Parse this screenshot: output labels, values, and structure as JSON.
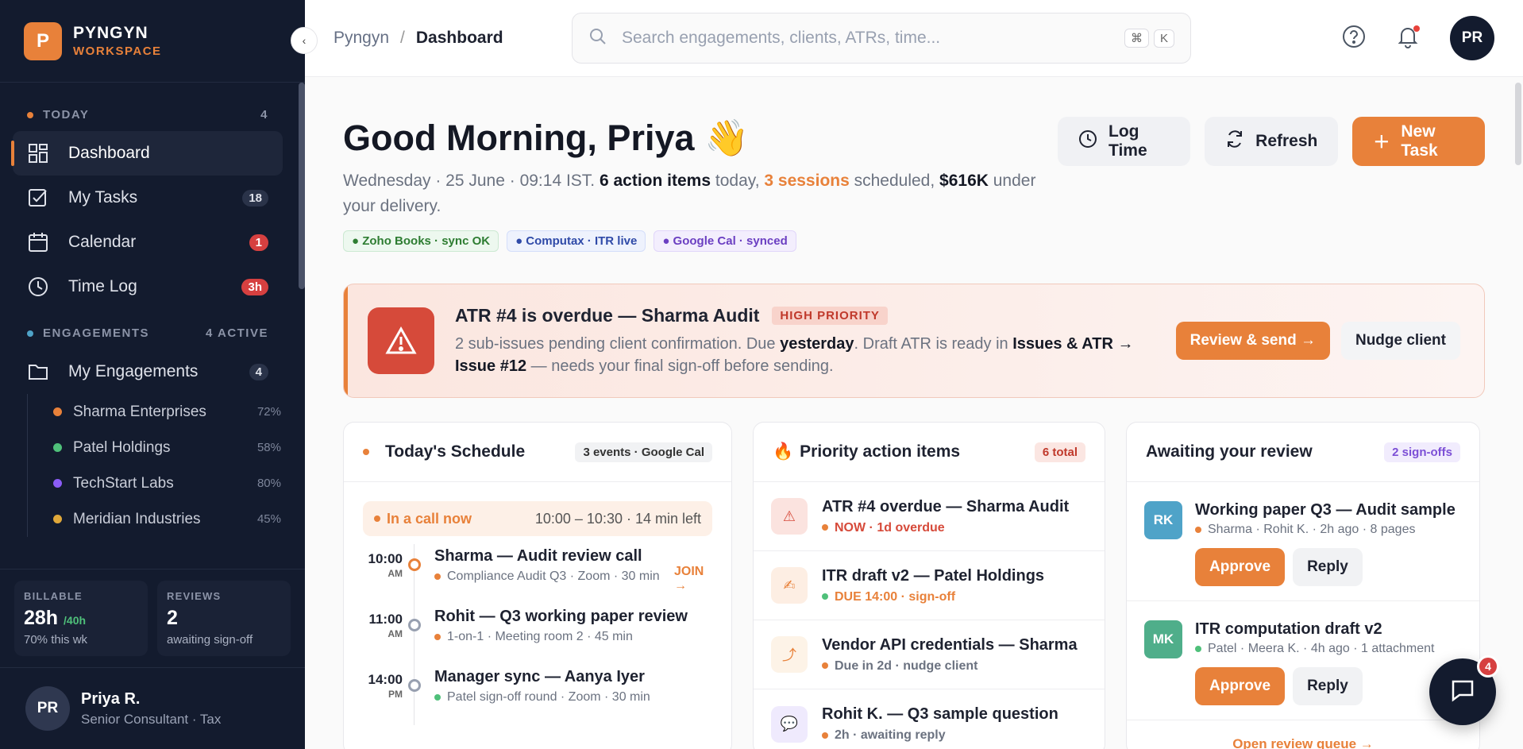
{
  "brand": {
    "initial": "P",
    "name": "PYNGYN",
    "sub": "WORKSPACE"
  },
  "sidebar": {
    "today_label": "TODAY",
    "today_count": "4",
    "nav": [
      {
        "label": "Dashboard",
        "badge": ""
      },
      {
        "label": "My Tasks",
        "badge": "18"
      },
      {
        "label": "Calendar",
        "badge": "1"
      },
      {
        "label": "Time Log",
        "badge": "3h"
      }
    ],
    "engagements_label": "ENGAGEMENTS",
    "engagements_count": "4 ACTIVE",
    "my_engagements": {
      "label": "My Engagements",
      "badge": "4"
    },
    "clients": [
      {
        "name": "Sharma Enterprises",
        "pct": "72%",
        "color": "#e8813a"
      },
      {
        "name": "Patel Holdings",
        "pct": "58%",
        "color": "#4fc07a"
      },
      {
        "name": "TechStart Labs",
        "pct": "80%",
        "color": "#8b5cf6"
      },
      {
        "name": "Meridian Industries",
        "pct": "45%",
        "color": "#e0a83a"
      }
    ],
    "stats": [
      {
        "label": "BILLABLE",
        "value": "28h",
        "extra": "/40h",
        "sub": "70% this wk"
      },
      {
        "label": "REVIEWS",
        "value": "2",
        "extra": "",
        "sub": "awaiting sign-off"
      }
    ],
    "user": {
      "initials": "PR",
      "name": "Priya R.",
      "role": "Senior Consultant · Tax"
    }
  },
  "topbar": {
    "crumb_root": "Pyngyn",
    "crumb_sep": "/",
    "crumb_page": "Dashboard",
    "search_placeholder": "Search engagements, clients, ATRs, time...",
    "kbd1": "⌘",
    "kbd2": "K",
    "avatar": "PR"
  },
  "hero": {
    "greeting": "Good Morning, Priya",
    "wave": "👋",
    "date": "Wednesday · 25 June · 09:14 IST.",
    "actions": "6 action items",
    "t1": " today, ",
    "sessions": "3 sessions",
    "t2": " scheduled, ",
    "amount": "$616K",
    "t3": " under your delivery.",
    "tags": [
      "● Zoho Books · sync OK",
      "● Computax · ITR live",
      "● Google Cal · synced"
    ],
    "btn_log": "Log Time",
    "btn_refresh": "Refresh",
    "btn_new": "New Task"
  },
  "alert": {
    "title": "ATR #4 is overdue — Sharma Audit",
    "priority": "HIGH PRIORITY",
    "d1": "2 sub-issues pending client confirmation. Due ",
    "d_bold": "yesterday",
    "d2": ". Draft ATR is ready in ",
    "d_bold2": "Issues & ATR → Issue #12",
    "d3": " — needs your final sign-off before sending.",
    "btn_review": "Review & send →",
    "btn_nudge": "Nudge client"
  },
  "schedule": {
    "title": "Today's Schedule",
    "chip": "3 events · Google Cal",
    "live_label": "In a call now",
    "live_time": "10:00 – 10:30 · 14 min left",
    "events": [
      {
        "time": "10:00",
        "ampm": "AM",
        "title": "Sharma — Audit review call",
        "sub": "Compliance Audit Q3 · Zoom · 30 min",
        "join": "JOIN →",
        "dot": "#e8813a"
      },
      {
        "time": "11:00",
        "ampm": "AM",
        "title": "Rohit — Q3 working paper review",
        "sub": "1-on-1 · Meeting room 2 · 45 min",
        "join": "",
        "dot": "#e8813a"
      },
      {
        "time": "14:00",
        "ampm": "PM",
        "title": "Manager sync — Aanya Iyer",
        "sub": "Patel sign-off round · Zoom · 30 min",
        "join": "",
        "dot": "#4fc07a"
      }
    ]
  },
  "priority": {
    "icon": "🔥",
    "title": "Priority action items",
    "chip": "6 total",
    "items": [
      {
        "icon": "⚠",
        "title": "ATR #4 overdue — Sharma Audit",
        "sub": "NOW · 1d overdue",
        "color": "#d64a3a",
        "bg": "#fbe3df",
        "dot": "#e8813a"
      },
      {
        "icon": "✍",
        "title": "ITR draft v2 — Patel Holdings",
        "sub": "DUE 14:00 · sign-off",
        "color": "#e8813a",
        "bg": "#fdeee3",
        "dot": "#4fc07a"
      },
      {
        "icon": "⤴",
        "title": "Vendor API credentials — Sharma",
        "sub": "Due in 2d · nudge client",
        "color": "#6b7280",
        "bg": "#fdf3e7",
        "dot": "#e8813a"
      },
      {
        "icon": "💬",
        "title": "Rohit K. — Q3 sample question",
        "sub": "2h · awaiting reply",
        "color": "#6b7280",
        "bg": "#efeafd",
        "dot": "#e8813a"
      }
    ]
  },
  "review": {
    "title": "Awaiting your review",
    "chip": "2 sign-offs",
    "items": [
      {
        "initials": "RK",
        "title": "Working paper Q3 — Audit sample",
        "sub": "Sharma · Rohit K. · 2h ago · 8 pages",
        "color": "#4fa3c8",
        "dot": "#e8813a",
        "approve": "Approve",
        "reply": "Reply"
      },
      {
        "initials": "MK",
        "title": "ITR computation draft v2",
        "sub": "Patel · Meera K. · 4h ago · 1 attachment",
        "color": "#4fae8a",
        "dot": "#4fc07a",
        "approve": "Approve",
        "reply": "Reply"
      }
    ],
    "queue": "Open review queue →"
  },
  "chat": {
    "badge": "4"
  }
}
